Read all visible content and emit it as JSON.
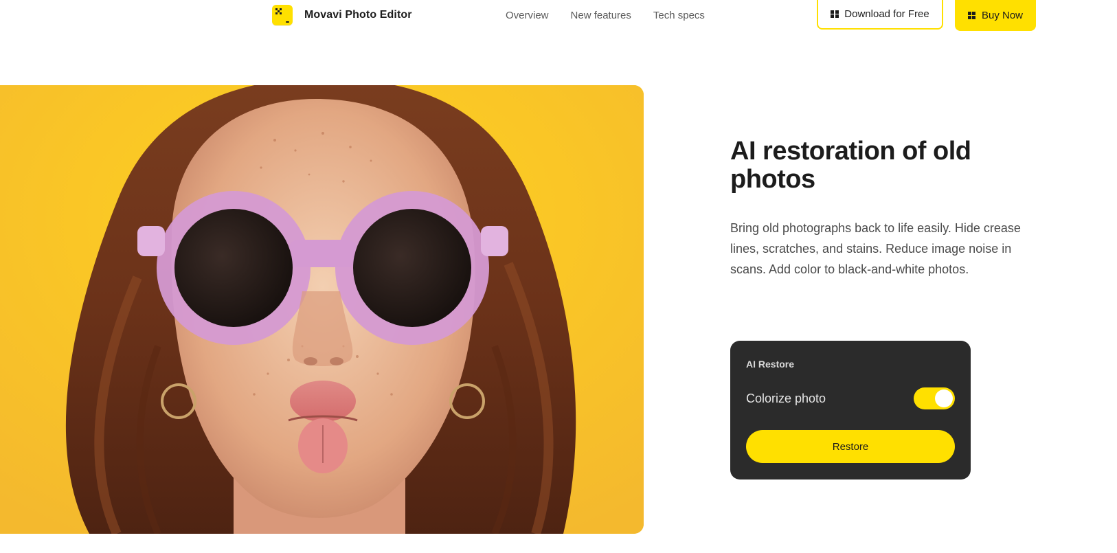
{
  "header": {
    "brand_name": "Movavi Photo Editor",
    "logo_icon": "movavi-logo-icon",
    "nav": [
      {
        "label": "Overview"
      },
      {
        "label": "New features"
      },
      {
        "label": "Tech specs"
      }
    ],
    "download_label": "Download for Free",
    "buy_label": "Buy Now",
    "button_icon": "windows-icon",
    "accent_color": "#ffe000"
  },
  "hero": {
    "image": "portrait-woman-pink-sunglasses-yellow-background",
    "background_color": "#f9cd2f"
  },
  "feature": {
    "title": "AI restoration of old photos",
    "description": "Bring old photographs back to life easily. Hide crease lines, scratches, and stains. Reduce image noise in scans. Add color to black-and-white photos."
  },
  "card": {
    "title": "AI Restore",
    "toggle_label": "Colorize photo",
    "toggle_on": true,
    "restore_label": "Restore",
    "background_color": "#2b2b2b"
  }
}
